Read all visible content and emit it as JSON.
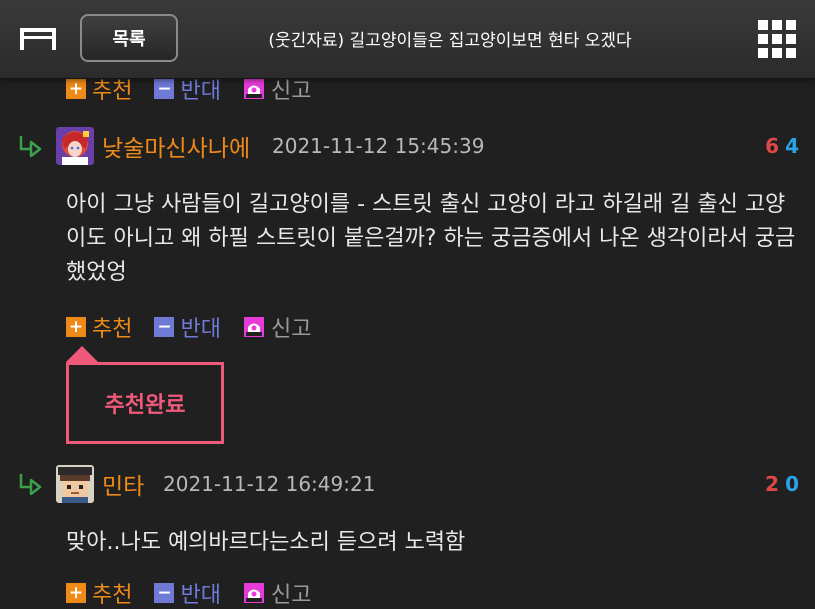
{
  "header": {
    "list_label": "목록",
    "title": "(웃긴자료) 길고양이들은 집고양이보면 현타 오겠다"
  },
  "actions": {
    "recommend": "추천",
    "oppose": "반대",
    "report": "신고"
  },
  "comments": [
    {
      "nickname": "낮술마신사나에",
      "date": "2021-11-12 15:45:39",
      "up": "6",
      "down": "4",
      "text": "아이 그냥 사람들이 길고양이를 - 스트릿 출신 고양이 라고 하길래 길 출신 고양이도 아니고 왜 하필 스트릿이 붙은걸까? 하는 궁금증에서 나온 생각이라서 궁금했었엉"
    },
    {
      "nickname": "민타",
      "date": "2021-11-12 16:49:21",
      "up": "2",
      "down": "0",
      "text": "맞아..나도 예의바르다는소리 듣으려 노력함"
    }
  ],
  "popup": {
    "label": "추천완료"
  },
  "colors": {
    "accent_orange": "#ef8a18",
    "oppose_blue": "#6f79d6",
    "popup_pink": "#f05a7a",
    "vote_red": "#e04848",
    "vote_blue": "#2aa3e6"
  }
}
